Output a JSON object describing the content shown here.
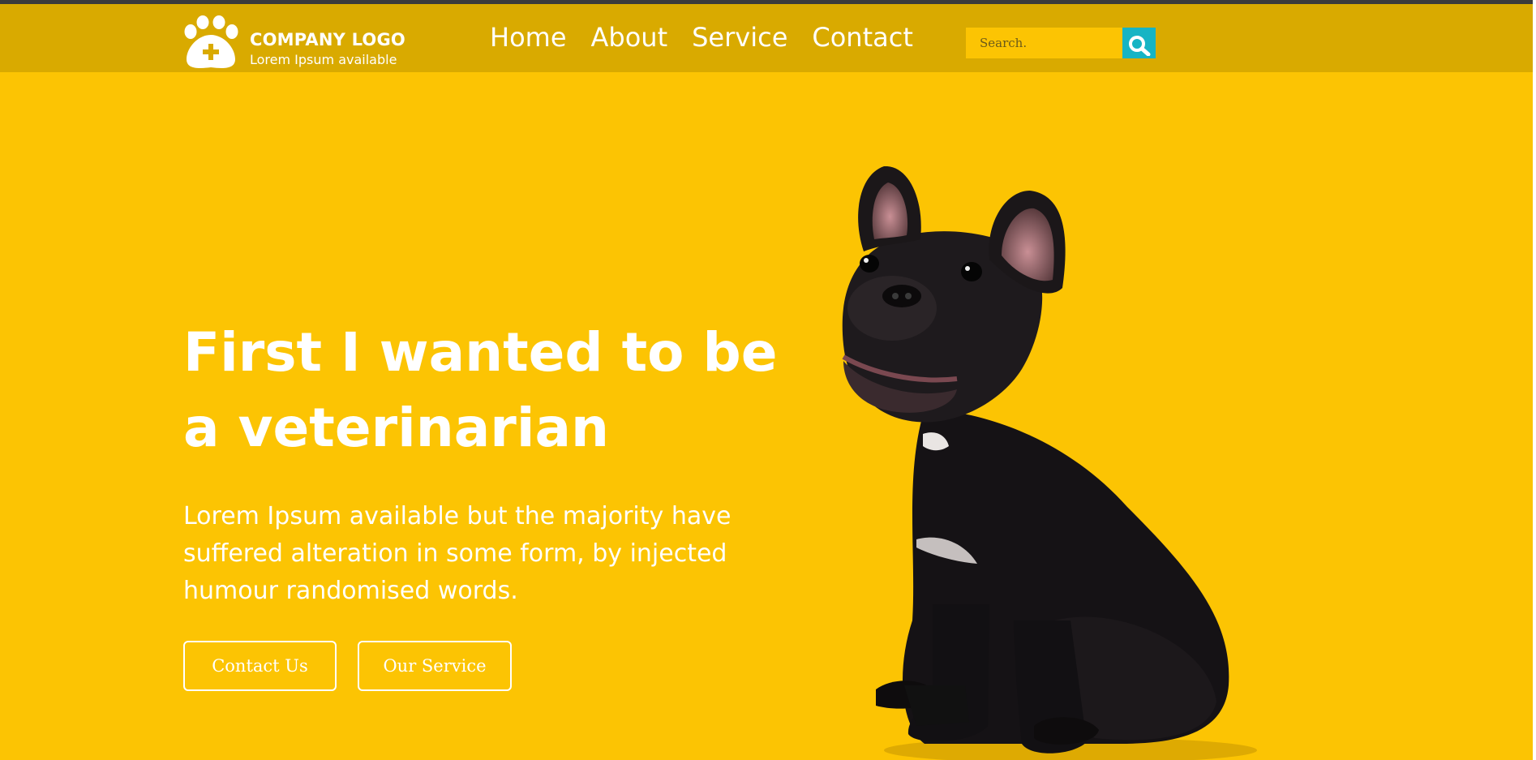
{
  "colors": {
    "page_background": "#fcc403",
    "header_background": "#d9aa00",
    "search_button": "#16b4c4",
    "text": "#ffffff"
  },
  "logo": {
    "icon": "paw-plus-icon",
    "title": "COMPANY LOGO",
    "tagline": "Lorem Ipsum available"
  },
  "nav": {
    "items": [
      {
        "label": "Home"
      },
      {
        "label": "About"
      },
      {
        "label": "Service"
      },
      {
        "label": "Contact"
      }
    ]
  },
  "search": {
    "placeholder": "Search.",
    "value": "",
    "button_icon": "search-icon"
  },
  "hero": {
    "title_line1": "First I wanted to be",
    "title_line2": "a veterinarian",
    "body": "Lorem Ipsum available but the majority have suffered alteration in some form, by injected humour randomised words.",
    "buttons": {
      "contact": "Contact Us",
      "service": "Our Service"
    },
    "image": "french-bulldog-photo"
  }
}
